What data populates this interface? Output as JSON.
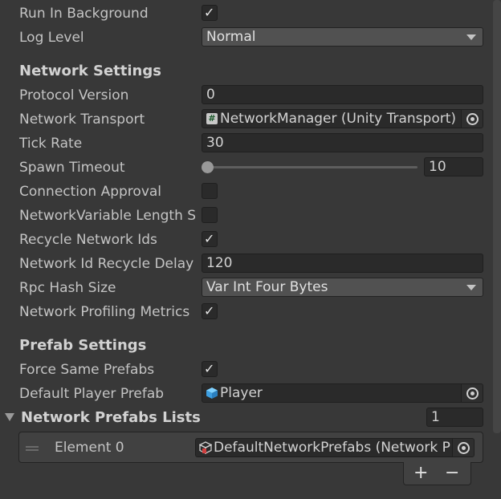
{
  "general": {
    "run_in_background": {
      "label": "Run In Background",
      "checked": true
    },
    "log_level": {
      "label": "Log Level",
      "value": "Normal"
    }
  },
  "network_settings": {
    "header": "Network Settings",
    "protocol_version": {
      "label": "Protocol Version",
      "value": "0"
    },
    "network_transport": {
      "label": "Network Transport",
      "value": "NetworkManager (Unity Transport)",
      "icon": "hash-script-icon"
    },
    "tick_rate": {
      "label": "Tick Rate",
      "value": "30"
    },
    "spawn_timeout": {
      "label": "Spawn Timeout",
      "value": "10"
    },
    "connection_approval": {
      "label": "Connection Approval",
      "checked": false
    },
    "networkvariable_length": {
      "label": "NetworkVariable Length S",
      "checked": false
    },
    "recycle_network_ids": {
      "label": "Recycle Network Ids",
      "checked": true
    },
    "network_id_recycle_delay": {
      "label": "Network Id Recycle Delay",
      "value": "120"
    },
    "rpc_hash_size": {
      "label": "Rpc Hash Size",
      "value": "Var Int Four Bytes"
    },
    "network_profiling_metrics": {
      "label": "Network Profiling Metrics",
      "checked": true
    }
  },
  "prefab_settings": {
    "header": "Prefab Settings",
    "force_same_prefabs": {
      "label": "Force Same Prefabs",
      "checked": true
    },
    "default_player_prefab": {
      "label": "Default Player Prefab",
      "value": "Player",
      "icon": "prefab-cube-icon"
    }
  },
  "network_prefabs_lists": {
    "header": "Network Prefabs Lists",
    "count": "1",
    "elements": [
      {
        "label": "Element 0",
        "value": "DefaultNetworkPrefabs (Network P",
        "icon": "scriptable-object-icon"
      }
    ],
    "add_label": "+",
    "remove_label": "−"
  },
  "colors": {
    "background": "#383838",
    "field": "#2a2a2a",
    "dropdown": "#515151",
    "text": "#c4c4c4"
  }
}
